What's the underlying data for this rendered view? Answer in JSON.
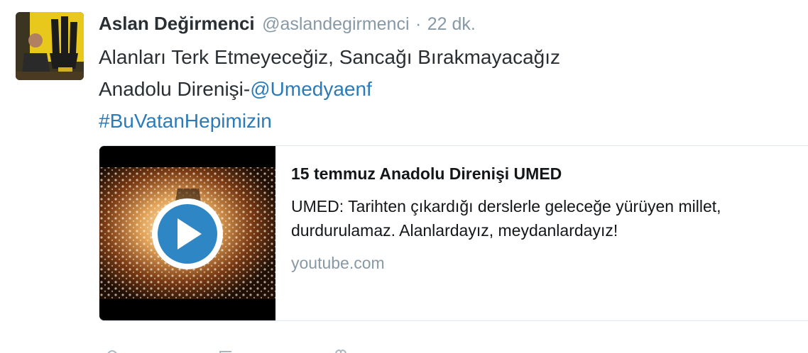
{
  "author": {
    "display_name": "Aslan Değirmenci",
    "username": "@aslandegirmenci",
    "separator": "·",
    "time": "22 dk."
  },
  "tweet": {
    "line1": "Alanları Terk Etmeyeceğiz, Sancağı Bırakmayacağız",
    "line2_prefix": "Anadolu Direnişi-",
    "mention": "@Umedyaenf",
    "hashtag": "#BuVatanHepimizin"
  },
  "card": {
    "title": "15 temmuz Anadolu Direnişi UMED",
    "description": "UMED: Tarihten çıkardığı derslerle geleceğe yürüyen millet, durdurulamaz. Alanlardayız, meydanlardayız!",
    "domain": "youtube.com"
  },
  "colors": {
    "link": "#2b7bb9",
    "text": "#292f33",
    "muted": "#8899a6",
    "play_button": "#2f86c4"
  },
  "icons": {
    "play": "play-icon"
  }
}
